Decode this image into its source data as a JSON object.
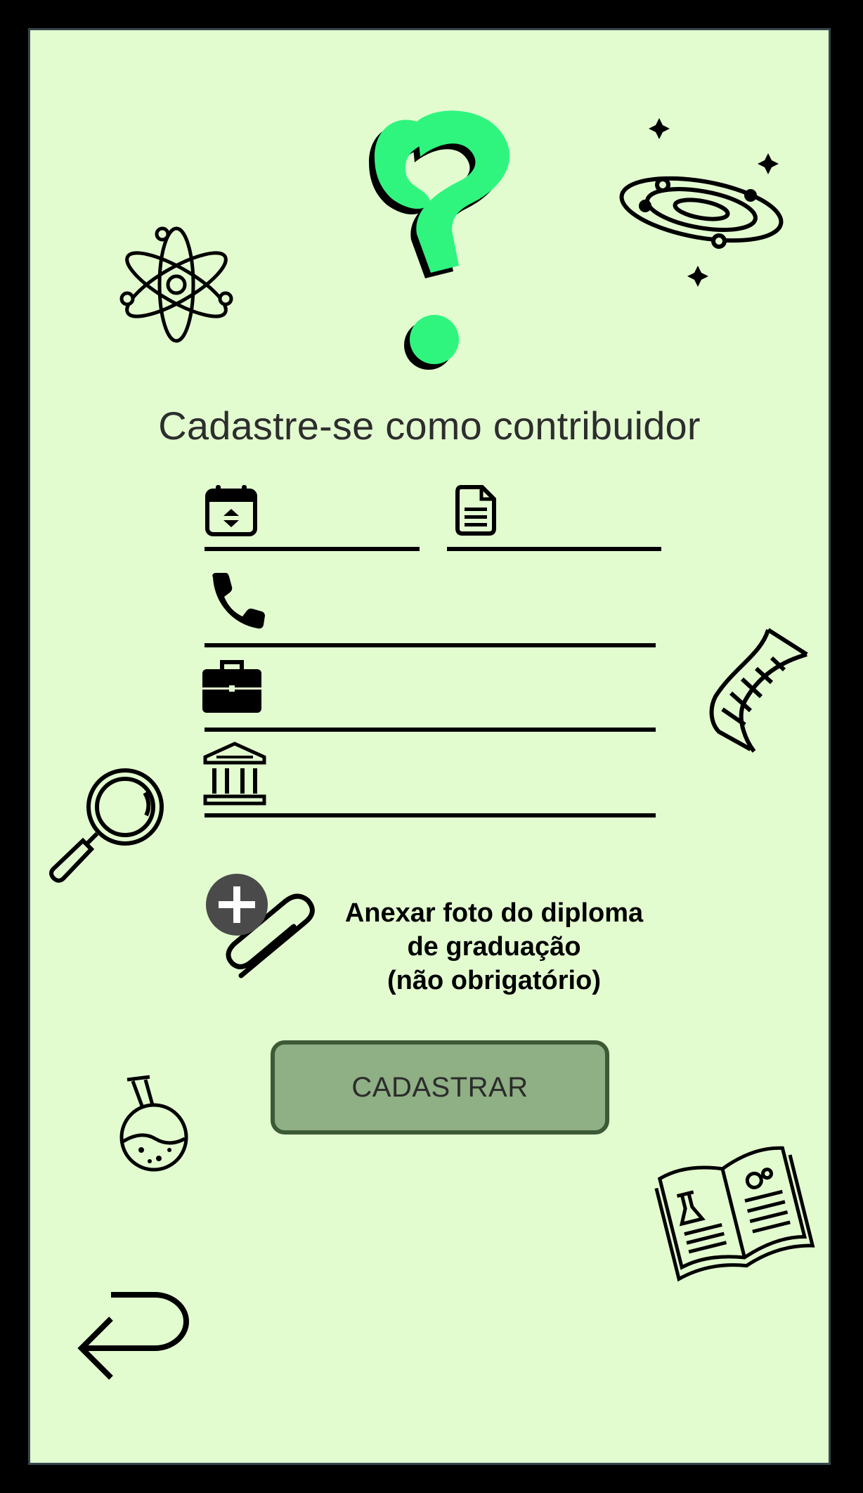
{
  "app": {
    "logo_icon": "question-mark-logo",
    "accent_color": "#2ff57e",
    "background_color": "#e2fcd0"
  },
  "page": {
    "title": "Cadastre-se como contribuidor"
  },
  "form": {
    "fields": [
      {
        "icon": "calendar-icon",
        "value": "",
        "placeholder": ""
      },
      {
        "icon": "document-icon",
        "value": "",
        "placeholder": ""
      },
      {
        "icon": "phone-icon",
        "value": "",
        "placeholder": ""
      },
      {
        "icon": "briefcase-icon",
        "value": "",
        "placeholder": ""
      },
      {
        "icon": "institution-icon",
        "value": "",
        "placeholder": ""
      }
    ],
    "attach": {
      "icon": "attach-plus-icon",
      "line1": "Anexar foto do diploma",
      "line2": "de graduação",
      "line3": "(não obrigatório)"
    },
    "submit_label": "CADASTRAR",
    "submit_color": "#8faf84"
  },
  "navigation": {
    "back_icon": "back-arrow-icon"
  },
  "decorations": [
    "atom-icon",
    "galaxy-icon",
    "dna-icon",
    "magnifier-icon",
    "flask-icon",
    "book-icon"
  ]
}
